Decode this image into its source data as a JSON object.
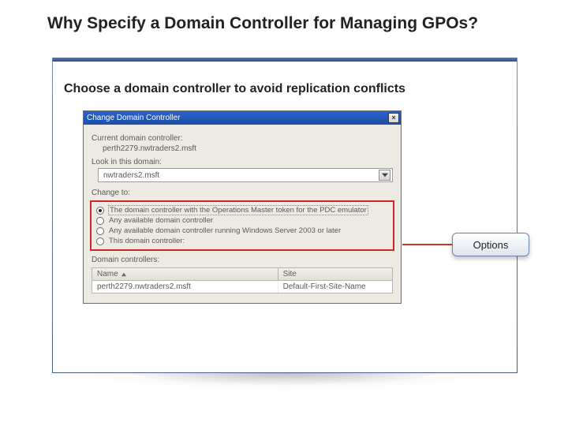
{
  "title": "Why Specify a Domain Controller for Managing GPOs?",
  "subtitle": "Choose a domain controller to avoid replication conflicts",
  "dialog": {
    "title": "Change Domain Controller",
    "current_lbl": "Current domain controller:",
    "current_val": "perth2279.nwtraders2.msft",
    "look_lbl": "Look in this domain:",
    "domain_value": "nwtraders2.msft",
    "change_lbl": "Change to:",
    "options": [
      "The domain controller with the Operations Master token for the PDC emulator",
      "Any available domain controller",
      "Any available domain controller running Windows Server 2003 or later",
      "This domain controller:"
    ],
    "selected_option_index": 0,
    "dc_section_lbl": "Domain controllers:",
    "grid": {
      "headers": {
        "name": "Name",
        "site": "Site"
      },
      "rows": [
        {
          "name": "perth2279.nwtraders2.msft",
          "site": "Default-First-Site-Name"
        }
      ]
    }
  },
  "callout_label": "Options"
}
